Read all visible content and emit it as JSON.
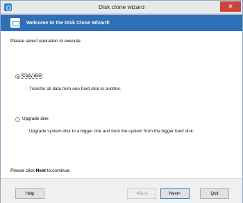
{
  "window": {
    "title": "Disk clone wizard",
    "close_label": "✕"
  },
  "banner": {
    "title": "Welcome to the Disk Clone Wizard!"
  },
  "main": {
    "prompt": "Please select operation to execute.",
    "options": [
      {
        "label": "Copy disk",
        "description": "Transfer all data from one hard disk to another.",
        "selected": true
      },
      {
        "label": "Upgrade disk",
        "description": "Upgrade system disk to a bigger one and boot the system from the bigger hard disk.",
        "selected": false
      }
    ],
    "continue_prefix": "Please click ",
    "continue_bold": "Next",
    "continue_suffix": " to continue."
  },
  "footer": {
    "help_label": "Help",
    "back_label": "<Back",
    "next_label": "Next>",
    "quit_label": "Quit"
  }
}
